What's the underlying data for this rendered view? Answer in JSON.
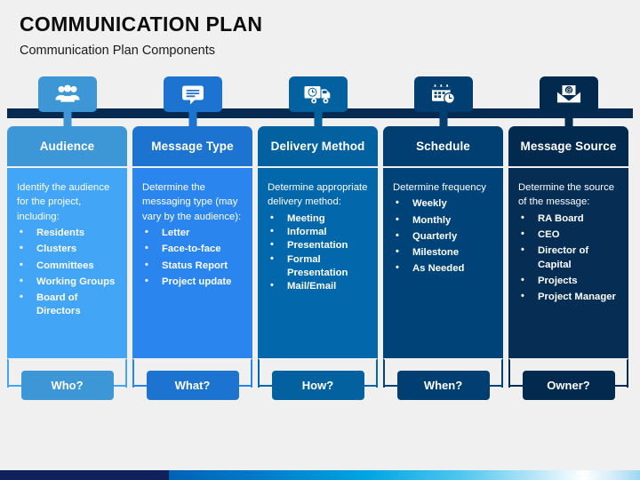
{
  "header": {
    "title": "COMMUNICATION PLAN",
    "subtitle": "Communication Plan Components"
  },
  "colors": {
    "col1": "#3d96d6",
    "col2": "#1d74d0",
    "col3": "#03619f",
    "col4": "#013f72",
    "col5": "#022a4e",
    "col1_body": "#42a5f5",
    "col2_body": "#2a86ee",
    "col3_body": "#0367ab",
    "col4_body": "#004379",
    "col5_body": "#062e55",
    "rail": "#062a52",
    "bottom_navy": "#10205c",
    "page_bg": "#f0f0f0"
  },
  "columns": [
    {
      "icon": "people-group-icon",
      "header": "Audience",
      "lead": "Identify the audience for the project, including:",
      "bullets": [
        "Residents",
        "Clusters",
        "Committees",
        "Working Groups",
        "Board of Directors"
      ],
      "button": "Who?"
    },
    {
      "icon": "chat-bubble-icon",
      "header": "Message Type",
      "lead": "Determine the messaging type (may vary by the audience):",
      "bullets": [
        "Letter",
        "Face-to-face",
        "Status Report",
        "Project update"
      ],
      "button": "What?"
    },
    {
      "icon": "delivery-truck-clock-icon",
      "header": "Delivery Method",
      "lead": "Determine appropriate delivery method:",
      "bullets": [
        "Meeting",
        "Informal",
        "Presentation",
        "Formal Presentation",
        "Mail/Email"
      ],
      "button": "How?"
    },
    {
      "icon": "calendar-clock-icon",
      "header": "Schedule",
      "lead": "Determine frequency",
      "bullets": [
        "Weekly",
        "Monthly",
        "Quarterly",
        "Milestone",
        "As Needed"
      ],
      "button": "When?"
    },
    {
      "icon": "envelope-at-icon",
      "header": "Message Source",
      "lead": "Determine the source of the message:",
      "bullets": [
        "RA Board",
        "CEO",
        "Director of Capital",
        "Projects",
        "Project Manager"
      ],
      "button": "Owner?"
    }
  ]
}
